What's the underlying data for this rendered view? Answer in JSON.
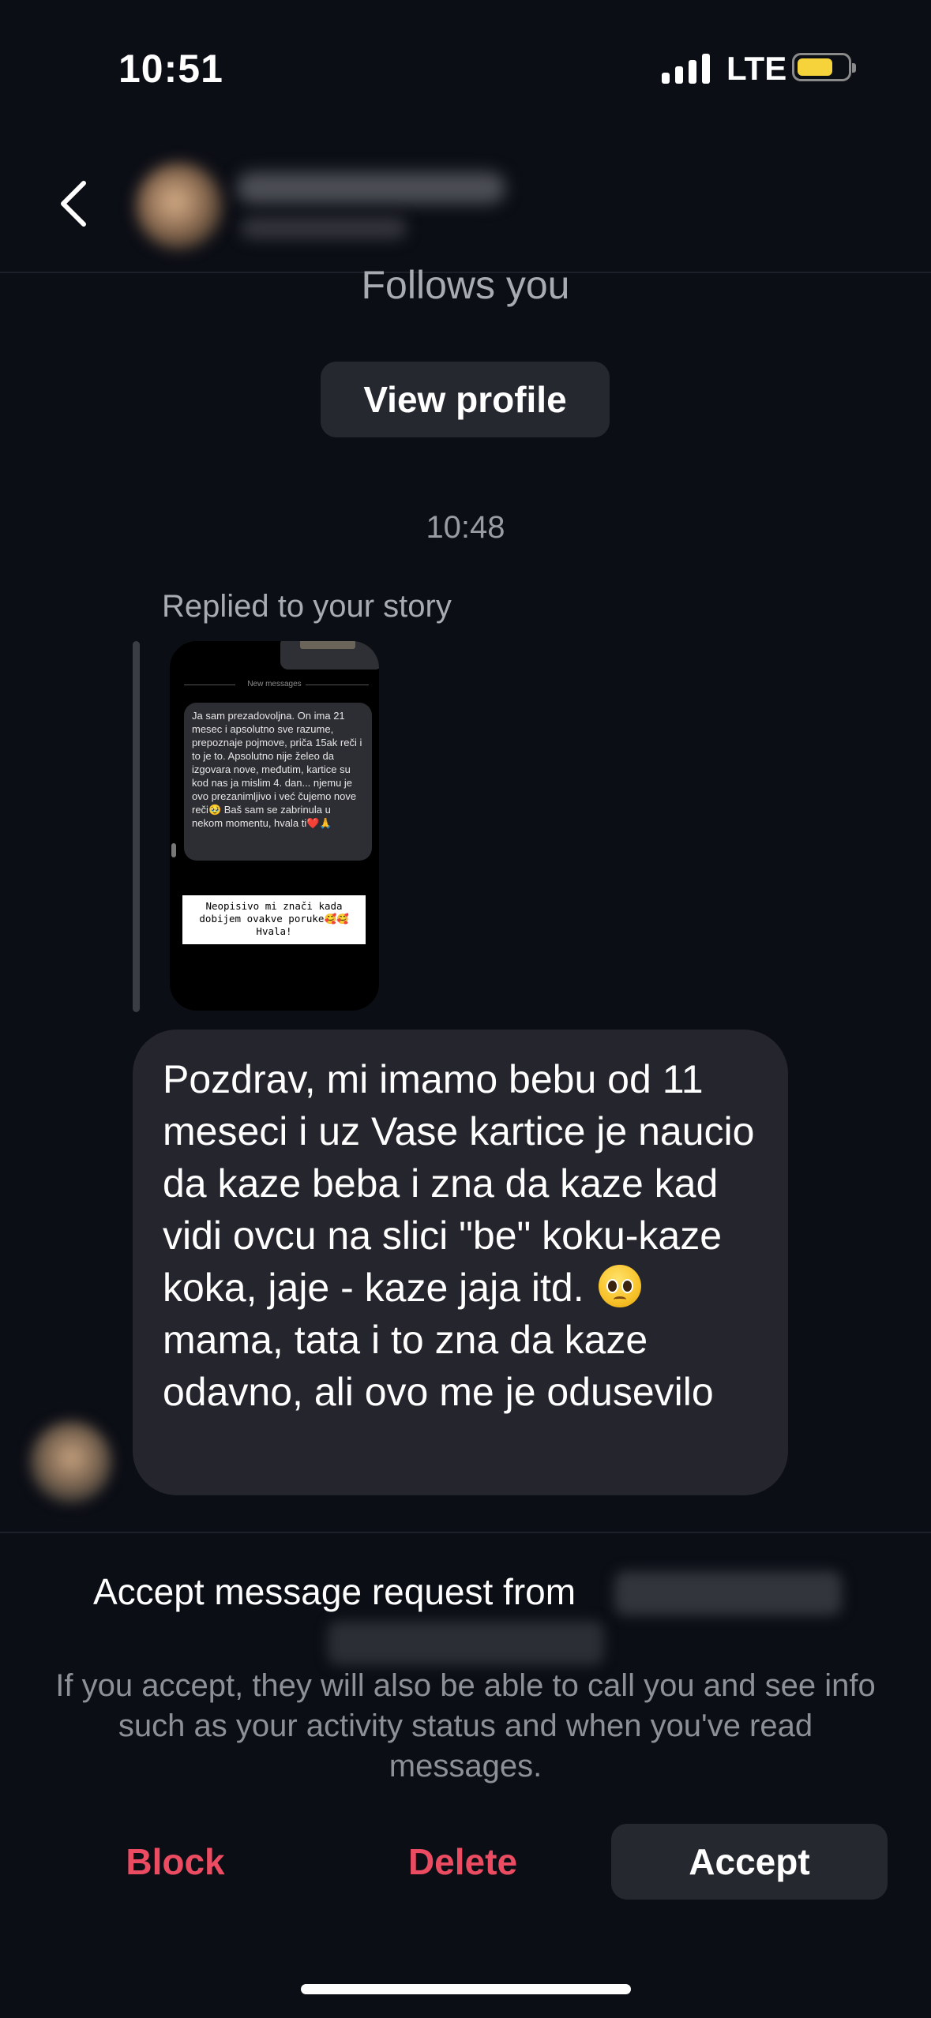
{
  "status_bar": {
    "time": "10:51",
    "network": "LTE",
    "battery_color": "#f7d33b"
  },
  "header": {
    "back_icon": "chevron-left-icon"
  },
  "profile": {
    "follows_text": "Follows you",
    "view_profile_label": "View profile"
  },
  "thread": {
    "timestamp": "10:48",
    "replied_label": "Replied to your story",
    "story": {
      "new_messages_label": "New messages",
      "quoted_text": "Ja sam prezadovoljna. On ima 21 mesec i apsolutno sve razume, prepoznaje pojmove, priča 15ak reči i to je to. Apsolutno nije želeo da izgovara nove, međutim, kartice su kod nas ja mislim 4. dan... njemu je ovo prezanimljivo i već čujemo nove reči🥹 Baš sam se zabrinula u nekom momentu, hvala ti❤️🙏",
      "caption": "Neopisivo mi znači kada dobijem ovakve poruke🥰🥰 Hvala!"
    },
    "message": {
      "text_before_emoji": "Pozdrav, mi imamo bebu od 11 meseci i uz Vase kartice je naucio da kaze beba i zna da kaze kad vidi ovcu na slici \"be\" koku-kaze koka, jaje - kaze jaja itd.",
      "emoji": "pleading-face-icon",
      "text_after_emoji": "mama, tata i to zna da kaze odavno, ali ovo me je odusevilo"
    }
  },
  "request": {
    "accept_text": "Accept message request from",
    "info_text": "If you accept, they will also be able to call you and see info such as your activity status and when you've read messages.",
    "block_label": "Block",
    "delete_label": "Delete",
    "accept_label": "Accept",
    "danger_color": "#ec4c62"
  }
}
